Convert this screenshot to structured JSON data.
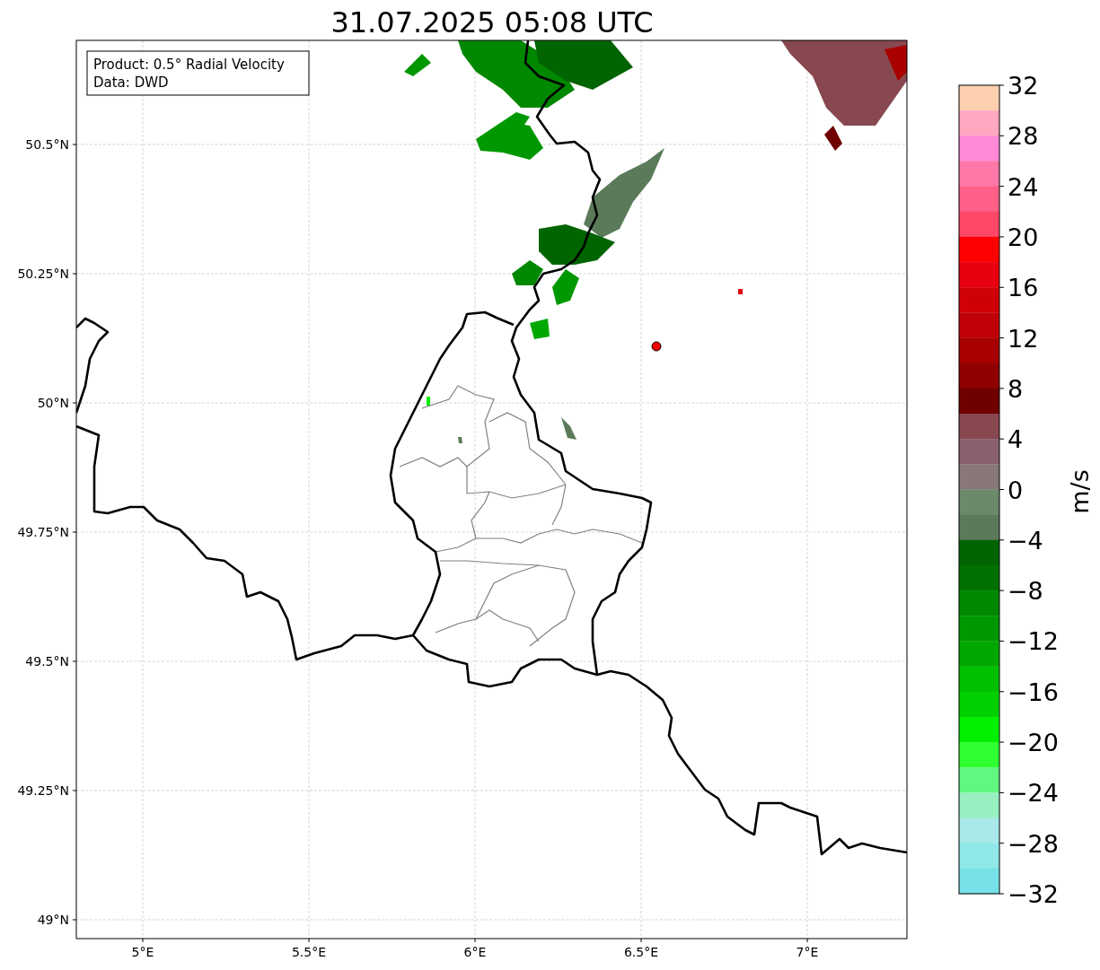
{
  "title": "31.07.2025 05:08 UTC",
  "info_box": {
    "lines": [
      "Product: 0.5° Radial Velocity",
      "Data: DWD"
    ]
  },
  "x_ticks": [
    "5°E",
    "5.5°E",
    "6°E",
    "6.5°E",
    "7°E"
  ],
  "y_ticks": [
    "50.5°N",
    "50.25°N",
    "50°N",
    "49.75°N",
    "49.5°N",
    "49.25°N",
    "49°N"
  ],
  "colorbar": {
    "label": "m/s",
    "tick_labels": [
      "32",
      "28",
      "24",
      "20",
      "16",
      "12",
      "8",
      "4",
      "0",
      "−4",
      "−8",
      "−12",
      "−16",
      "−20",
      "−24",
      "−28",
      "−32"
    ],
    "bins": [
      {
        "color": "#ffd0b0"
      },
      {
        "color": "#ffa8c0"
      },
      {
        "color": "#ff88d8"
      },
      {
        "color": "#ff78a8"
      },
      {
        "color": "#ff6088"
      },
      {
        "color": "#ff4868"
      },
      {
        "color": "#ff0000"
      },
      {
        "color": "#e60010"
      },
      {
        "color": "#d00008"
      },
      {
        "color": "#c00008"
      },
      {
        "color": "#a80000"
      },
      {
        "color": "#900000"
      },
      {
        "color": "#700000"
      },
      {
        "color": "#884850"
      },
      {
        "color": "#886070"
      },
      {
        "color": "#887878"
      },
      {
        "color": "#6a8a6a"
      },
      {
        "color": "#5a7a5a"
      },
      {
        "color": "#006400"
      },
      {
        "color": "#007000"
      },
      {
        "color": "#008800"
      },
      {
        "color": "#009800"
      },
      {
        "color": "#00a800"
      },
      {
        "color": "#00c000"
      },
      {
        "color": "#00d000"
      },
      {
        "color": "#00f000"
      },
      {
        "color": "#30ff30"
      },
      {
        "color": "#60f880"
      },
      {
        "color": "#98f0c0"
      },
      {
        "color": "#a8e8e8"
      },
      {
        "color": "#90e8e8"
      },
      {
        "color": "#78e0e8"
      }
    ]
  }
}
